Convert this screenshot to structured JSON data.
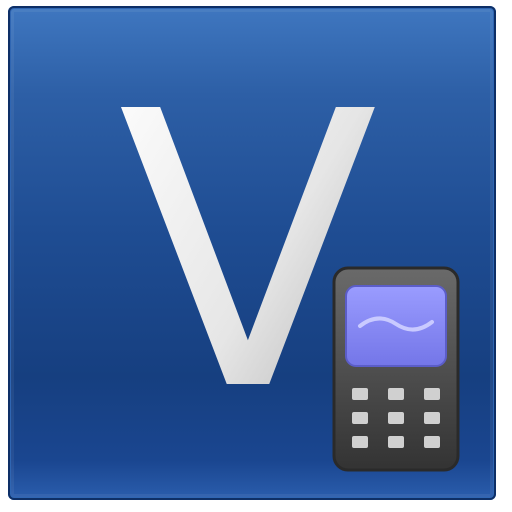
{
  "app_icon": {
    "letter": "V",
    "colors": {
      "background_top": "#3f77c0",
      "background_mid": "#1f4d93",
      "background_bottom": "#163f80",
      "letter": "#f2f2f2",
      "phone_body": "#4a4a4a",
      "phone_screen": "#8a8cf5",
      "keypad_keys": "#d0d0d0"
    },
    "icons": {
      "badge": "mobile-phone-icon"
    }
  }
}
